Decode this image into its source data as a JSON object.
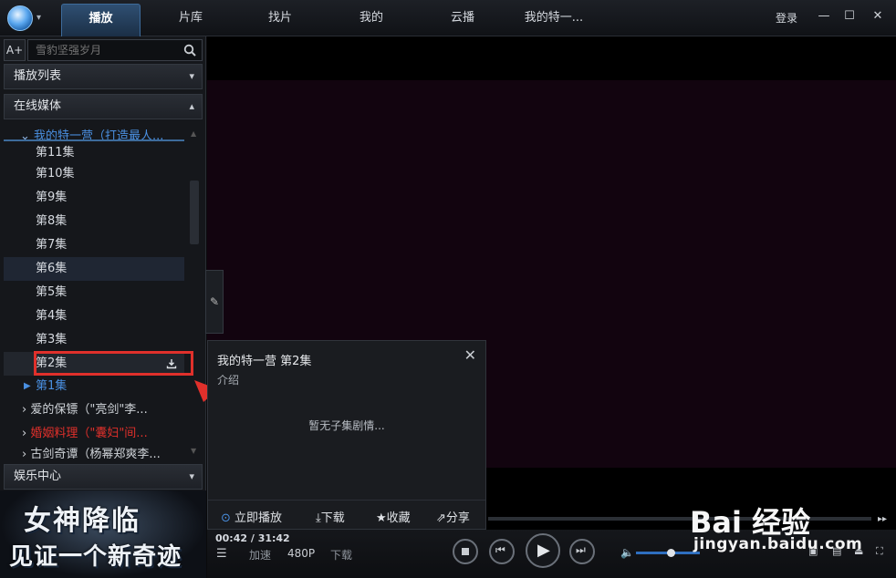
{
  "topbar": {
    "tabs": [
      "播放",
      "片库",
      "找片",
      "我的",
      "云播",
      "我的特一..."
    ],
    "active_tab": 0,
    "login": "登录"
  },
  "sidebar": {
    "font_button": "A+",
    "search_placeholder": "雪豹坚强岁月",
    "sections": {
      "playlist": "播放列表",
      "online_media": "在线媒体",
      "entertainment": "娱乐中心"
    },
    "expanded_show": "我的特一营（打造最人...",
    "episodes": [
      "第11集",
      "第10集",
      "第9集",
      "第8集",
      "第7集",
      "第6集",
      "第5集",
      "第4集",
      "第3集",
      "第2集",
      "第1集"
    ],
    "other_shows": [
      {
        "title": "爱的保镖（\"亮剑\"李...",
        "color": "#d6dae0"
      },
      {
        "title": "婚姻料理（\"囊妇\"间...",
        "color": "#e0302b"
      },
      {
        "title": "古剑奇谭（杨幂郑爽李...",
        "color": "#d6dae0"
      }
    ]
  },
  "popup": {
    "title": "我的特一营   第2集",
    "subtitle": "介绍",
    "empty_text": "暂无子集剧情...",
    "actions": [
      "立即播放",
      "下载",
      "收藏",
      "分享"
    ]
  },
  "player": {
    "time": "00:42 / 31:42",
    "speed": "加速",
    "quality": "480P",
    "download": "下载",
    "volume": 0.5
  },
  "banner": {
    "line1": "女神降临",
    "line2": "见证一个新奇迹"
  },
  "watermark": {
    "brand": "Bai 经验",
    "url": "jingyan.baidu.com"
  },
  "colors": {
    "accent": "#3d6b9b",
    "highlight_link": "#4a90e2",
    "annotation_red": "#e0302b"
  }
}
